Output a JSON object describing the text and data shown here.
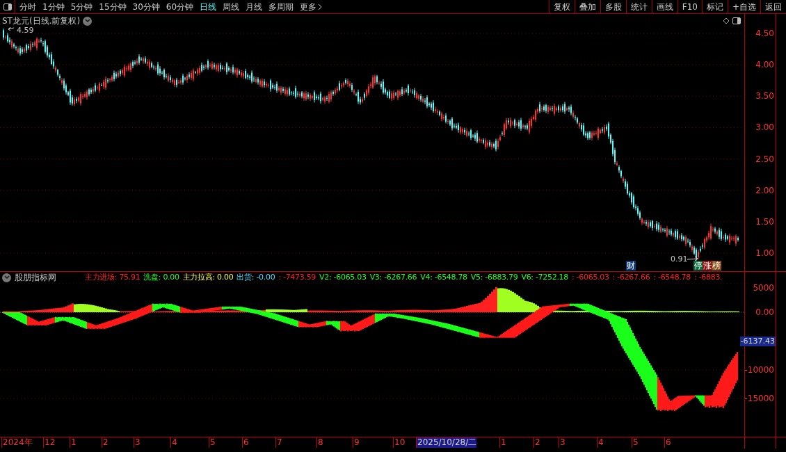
{
  "toolbar": {
    "periods": [
      {
        "label": "分时",
        "selected": false
      },
      {
        "label": "1分钟",
        "selected": false
      },
      {
        "label": "5分钟",
        "selected": false
      },
      {
        "label": "15分钟",
        "selected": false
      },
      {
        "label": "30分钟",
        "selected": false
      },
      {
        "label": "60分钟",
        "selected": false
      },
      {
        "label": "日线",
        "selected": true
      },
      {
        "label": "周线",
        "selected": false
      },
      {
        "label": "月线",
        "selected": false
      },
      {
        "label": "多周期",
        "selected": false
      }
    ],
    "more": "更多",
    "actions": [
      "复权",
      "叠加",
      "多股",
      "统计",
      "画线",
      "F10",
      "标记",
      "+自选",
      "返回"
    ]
  },
  "price_chart": {
    "title": "ST龙元(日线.前复权)",
    "axis_labels": [
      "4.50",
      "4.00",
      "3.50",
      "3.00",
      "2.50",
      "2.00",
      "1.50",
      "1.00"
    ],
    "high_label": "4.59",
    "low_label": "0.91",
    "markers": [
      {
        "label": "财",
        "color": "#0a3a7a"
      },
      {
        "label": "停",
        "color": "#0a6a3a"
      },
      {
        "label": "涨",
        "color": "#8a1010"
      },
      {
        "label": "榜",
        "color": "#8a4a10"
      }
    ]
  },
  "indicator": {
    "name": "股朋指标网",
    "readings": [
      {
        "text": "主力进场: 75.91",
        "color": "#ff2020"
      },
      {
        "text": "洗盘: 0.00",
        "color": "#20ff20"
      },
      {
        "text": "主力拉高: 0.00",
        "color": "#ffff40"
      },
      {
        "text": "出货: -0.00",
        "color": "#40e0ff"
      },
      {
        "text": ": -7473.59",
        "color": "#ff2020"
      },
      {
        "text": "V2: -6065.03",
        "color": "#20ff20"
      },
      {
        "text": "V3: -6267.66",
        "color": "#20ff20"
      },
      {
        "text": "V4: -6548.78",
        "color": "#20ff20"
      },
      {
        "text": "V5: -6883.79",
        "color": "#20ff20"
      },
      {
        "text": "V6: -7252.18",
        "color": "#20ff20"
      },
      {
        "text": ": -6065.03",
        "color": "#ff2020"
      },
      {
        "text": ": -6267.66",
        "color": "#ff2020"
      },
      {
        "text": ": -6548.78",
        "color": "#ff2020"
      },
      {
        "text": ": -6883.",
        "color": "#ff2020"
      }
    ],
    "axis_labels": [
      "5000",
      "0.00",
      "-10000",
      "-15000"
    ],
    "current_value": "-6137.43"
  },
  "time_axis": {
    "labels": [
      "2024年",
      "12",
      "1",
      "2",
      "3",
      "4",
      "5",
      "6",
      "7",
      "8",
      "9",
      "10",
      "2025/10/28/二",
      "1",
      "2",
      "3",
      "4",
      "5",
      "6"
    ]
  }
}
